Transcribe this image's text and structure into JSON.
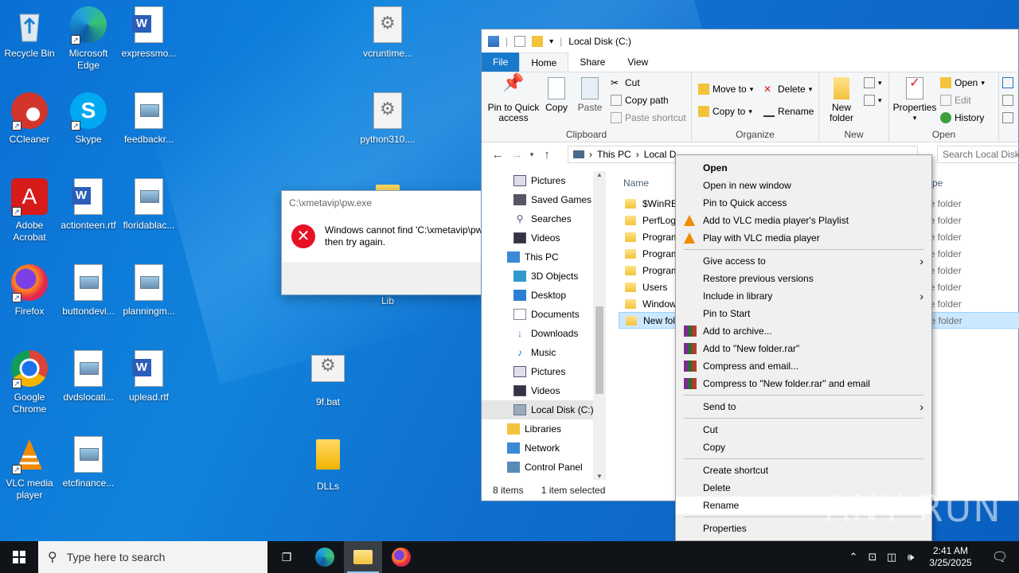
{
  "desktop": {
    "icons": [
      {
        "label": "Recycle Bin",
        "icon": "recycle-bin-icon"
      },
      {
        "label": "Microsoft Edge",
        "icon": "edge-icon"
      },
      {
        "label": "expressmo...",
        "icon": "word-doc-icon"
      },
      {
        "label": "vcruntime...",
        "icon": "dll-file-icon"
      },
      {
        "label": "CCleaner",
        "icon": "ccleaner-icon"
      },
      {
        "label": "Skype",
        "icon": "skype-icon"
      },
      {
        "label": "feedbackr...",
        "icon": "image-file-icon"
      },
      {
        "label": "python310....",
        "icon": "dll-file-icon"
      },
      {
        "label": "Adobe Acrobat",
        "icon": "acrobat-icon"
      },
      {
        "label": "actionteen.rtf",
        "icon": "word-doc-icon"
      },
      {
        "label": "floridablac...",
        "icon": "image-file-icon"
      },
      {
        "label": "Firefox",
        "icon": "firefox-icon"
      },
      {
        "label": "buttondevi...",
        "icon": "image-file-icon"
      },
      {
        "label": "planningm...",
        "icon": "image-file-icon"
      },
      {
        "label": "Lib",
        "icon": "folder-icon"
      },
      {
        "label": "Google Chrome",
        "icon": "chrome-icon"
      },
      {
        "label": "dvdslocati...",
        "icon": "image-file-icon"
      },
      {
        "label": "uplead.rtf",
        "icon": "word-doc-icon"
      },
      {
        "label": "9f.bat",
        "icon": "bat-file-icon"
      },
      {
        "label": "VLC media player",
        "icon": "vlc-icon"
      },
      {
        "label": "etcfinance...",
        "icon": "image-file-icon"
      },
      {
        "label": "DLLs",
        "icon": "folder-icon"
      }
    ]
  },
  "error_dialog": {
    "title": "C:\\xmetavip\\pw.exe",
    "message_line1": "Windows cannot find 'C:\\xmetavip\\pw",
    "message_line2": "then try again."
  },
  "explorer": {
    "title": "Local Disk (C:)",
    "tabs": [
      "File",
      "Home",
      "Share",
      "View"
    ],
    "ribbon": {
      "clipboard": {
        "label": "Clipboard",
        "pin": "Pin to Quick access",
        "copy": "Copy",
        "paste": "Paste",
        "cut": "Cut",
        "copy_path": "Copy path",
        "paste_shortcut": "Paste shortcut"
      },
      "organize": {
        "label": "Organize",
        "move_to": "Move to",
        "copy_to": "Copy to",
        "delete": "Delete",
        "rename": "Rename"
      },
      "new": {
        "label": "New",
        "new_folder": "New folder"
      },
      "open": {
        "label": "Open",
        "properties": "Properties",
        "open": "Open",
        "edit": "Edit",
        "history": "History"
      }
    },
    "address": {
      "this_pc": "This PC",
      "local": "Local D"
    },
    "search_placeholder": "Search Local Disk (C:)",
    "nav": [
      {
        "label": "Pictures",
        "icon": "pictures-icon"
      },
      {
        "label": "Saved Games",
        "icon": "saved-games-icon"
      },
      {
        "label": "Searches",
        "icon": "search-icon"
      },
      {
        "label": "Videos",
        "icon": "videos-icon"
      },
      {
        "label": "This PC",
        "icon": "this-pc-icon"
      },
      {
        "label": "3D Objects",
        "icon": "3d-objects-icon"
      },
      {
        "label": "Desktop",
        "icon": "desktop-icon"
      },
      {
        "label": "Documents",
        "icon": "documents-icon"
      },
      {
        "label": "Downloads",
        "icon": "downloads-icon"
      },
      {
        "label": "Music",
        "icon": "music-icon"
      },
      {
        "label": "Pictures",
        "icon": "pictures-icon"
      },
      {
        "label": "Videos",
        "icon": "videos-icon"
      },
      {
        "label": "Local Disk (C:)",
        "icon": "drive-icon"
      },
      {
        "label": "Libraries",
        "icon": "libraries-icon"
      },
      {
        "label": "Network",
        "icon": "network-icon"
      },
      {
        "label": "Control Panel",
        "icon": "control-panel-icon"
      }
    ],
    "columns": {
      "name": "Name",
      "type": "ype"
    },
    "files": [
      {
        "name": "$WinREA",
        "type": "le folder"
      },
      {
        "name": "PerfLogs",
        "type": "le folder"
      },
      {
        "name": "Program",
        "type": "le folder"
      },
      {
        "name": "Program",
        "type": "le folder"
      },
      {
        "name": "Program",
        "type": "le folder"
      },
      {
        "name": "Users",
        "type": "le folder"
      },
      {
        "name": "Window",
        "type": "le folder"
      },
      {
        "name": "New fold",
        "type": "le folder"
      }
    ],
    "status": {
      "count": "8 items",
      "selected": "1 item selected"
    }
  },
  "context_menu": {
    "items": [
      {
        "label": "Open"
      },
      {
        "label": "Open in new window"
      },
      {
        "label": "Pin to Quick access"
      },
      {
        "label": "Add to VLC media player's Playlist"
      },
      {
        "label": "Play with VLC media player"
      },
      {
        "label": "Give access to"
      },
      {
        "label": "Restore previous versions"
      },
      {
        "label": "Include in library"
      },
      {
        "label": "Pin to Start"
      },
      {
        "label": "Add to archive..."
      },
      {
        "label": "Add to \"New folder.rar\""
      },
      {
        "label": "Compress and email..."
      },
      {
        "label": "Compress to \"New folder.rar\" and email"
      },
      {
        "label": "Send to"
      },
      {
        "label": "Cut"
      },
      {
        "label": "Copy"
      },
      {
        "label": "Create shortcut"
      },
      {
        "label": "Delete"
      },
      {
        "label": "Rename"
      },
      {
        "label": "Properties"
      }
    ]
  },
  "watermark": "ANY RUN",
  "taskbar": {
    "search_placeholder": "Type here to search",
    "time": "2:41 AM",
    "date": "3/25/2025"
  },
  "colors": {
    "accent": "#1979ca",
    "selection": "#cce8ff",
    "taskbar": "#101419"
  }
}
